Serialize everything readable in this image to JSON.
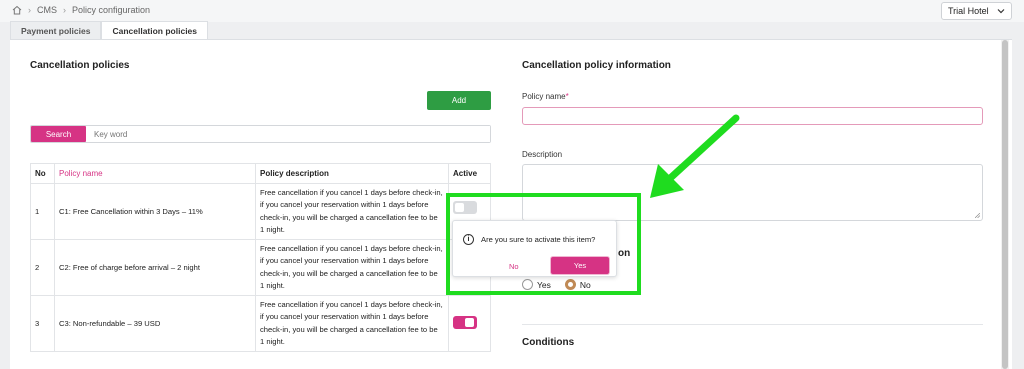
{
  "breadcrumb": {
    "home_icon": "home-icon",
    "items": [
      "CMS",
      "Policy configuration"
    ]
  },
  "hotel_selector": {
    "value": "Trial Hotel"
  },
  "tabs": [
    {
      "label": "Payment policies"
    },
    {
      "label": "Cancellation policies"
    }
  ],
  "left": {
    "title": "Cancellation policies",
    "add_label": "Add",
    "search_label": "Search",
    "search_placeholder": "Key word",
    "table": {
      "headers": [
        "No",
        "Policy name",
        "Policy description",
        "Active"
      ],
      "rows": [
        {
          "no": "1",
          "name": "C1: Free Cancellation within 3 Days – 11%",
          "desc": "Free cancellation if you cancel 1 days before check-in, if you cancel your reservation within 1 days before check-in, you will be charged a cancellation fee to be 1 night.",
          "active": false
        },
        {
          "no": "2",
          "name": "C2: Free of charge before arrival – 2 night",
          "desc": "Free cancellation if you cancel 1 days before check-in, if you cancel your reservation within 1 days before check-in, you will be charged a cancellation fee to be 1 night.",
          "active": false
        },
        {
          "no": "3",
          "name": "C3: Non-refundable – 39 USD",
          "desc": "Free cancellation if you cancel 1 days before check-in, if you cancel your reservation within 1 days before check-in, you will be charged a cancellation fee to be 1 night.",
          "active": true
        }
      ]
    }
  },
  "right": {
    "title": "Cancellation policy information",
    "policy_name_label": "Policy name",
    "required_mark": "*",
    "description_label": "Description",
    "partial_heading": "on",
    "radio_yes": "Yes",
    "radio_no": "No",
    "conditions_label": "Conditions"
  },
  "popover": {
    "message": "Are you sure to activate this item?",
    "no_label": "No",
    "yes_label": "Yes"
  },
  "colors": {
    "accent": "#d63384",
    "add_green": "#2e9d43",
    "highlight": "#1fdc1f"
  }
}
